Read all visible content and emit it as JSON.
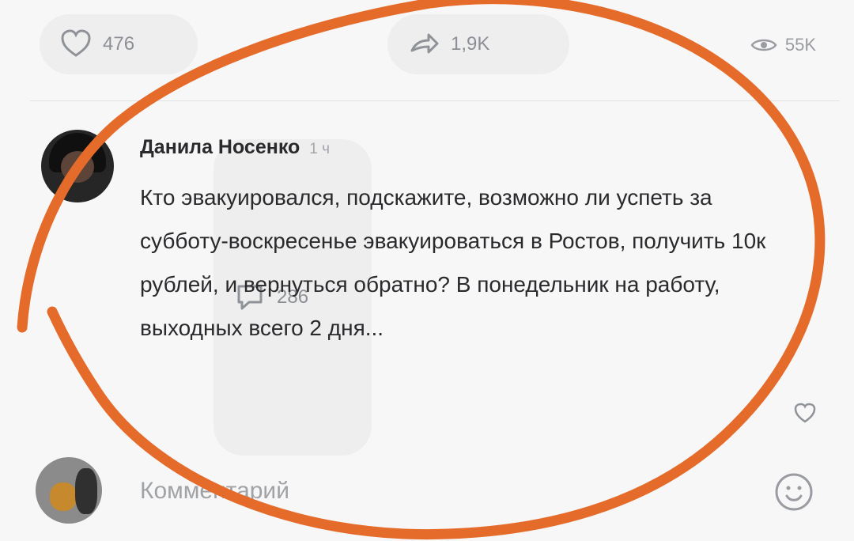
{
  "post_actions": {
    "likes": "476",
    "comments": "286",
    "shares": "1,9K",
    "views": "55K"
  },
  "comment": {
    "author": "Данила Носенко",
    "time": "1 ч",
    "text": "Кто эвакуировался, подскажите, возможно ли успеть за субботу-воскресенье эвакуироваться в Ростов, получить 10к рублей, и вернуться обратно? В понедельник на работу, выходных всего 2 дня..."
  },
  "comment_input": {
    "placeholder": "Комментарий"
  },
  "annotation": {
    "color": "#e56b2a"
  }
}
